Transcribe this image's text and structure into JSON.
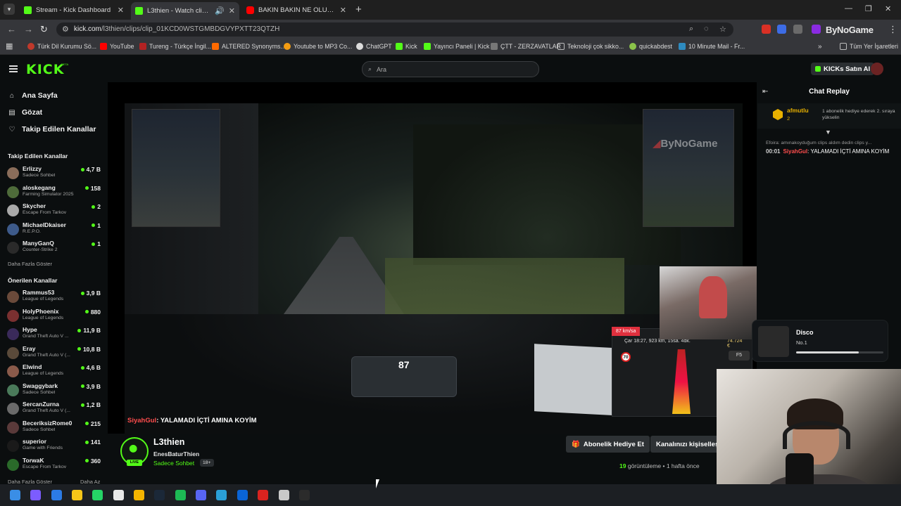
{
  "browser": {
    "tabs": [
      {
        "label": "Stream - Kick Dashboard",
        "favicon": "kick-icon"
      },
      {
        "label": "L3thien - Watch clips on Kick",
        "favicon": "kick-icon"
      },
      {
        "label": "BAKIN BAKIN NE OLUYOR? | 5...",
        "favicon": "youtube-icon"
      }
    ],
    "url_host": "kick.com",
    "url_path": "/l3thien/clips/clip_01KCD0WSTGMBDGVYPXTT23QTZH",
    "brand_overlay": "ByNoGame",
    "bookmarks": [
      "Türk Dil Kurumu Sö...",
      "YouTube",
      "Tureng - Türkçe İngil...",
      "ALTERED Synonyms...",
      "Youtube to MP3 Co...",
      "ChatGPT",
      "Kick",
      "Yayıncı Paneli | Kick",
      "ÇTT - ZERZAVATLAR",
      "Teknoloji çok sikko...",
      "quickabdest",
      "10 Minute Mail - Fr...",
      "Tüm Yer İşaretleri"
    ]
  },
  "kick": {
    "logo": "KICK",
    "logo_beta": "BETA",
    "search_placeholder": "Ara",
    "kicks_button": "KICKs Satın Al",
    "nav": [
      "Ana Sayfa",
      "Gözat",
      "Takip Edilen Kanallar"
    ],
    "followed_title": "Takip Edilen Kanallar",
    "followed": [
      {
        "name": "Erlizzy",
        "game": "Sadece Sohbet",
        "viewers": "4,7 B",
        "color": "#8a6d5a"
      },
      {
        "name": "aloskegang",
        "game": "Farming Simulator 2025",
        "viewers": "158",
        "color": "#4e6b3a"
      },
      {
        "name": "Skycher",
        "game": "Escape From Tarkov",
        "viewers": "2",
        "color": "#a9a9a9"
      },
      {
        "name": "MichaelDkaiser",
        "game": "R.E.P.O.",
        "viewers": "1",
        "color": "#3d5a8a"
      },
      {
        "name": "ManyGanQ",
        "game": "Counter-Strike 2",
        "viewers": "1",
        "color": "#2a2a2a"
      }
    ],
    "show_more": "Daha Fazla Göster",
    "recommended_title": "Önerilen Kanallar",
    "recommended": [
      {
        "name": "Rammus53",
        "game": "League of Legends",
        "viewers": "3,9 B",
        "color": "#6a4a3a"
      },
      {
        "name": "HolyPhoenix",
        "game": "League of Legends",
        "viewers": "880",
        "color": "#7a3030"
      },
      {
        "name": "Hype",
        "game": "Grand Theft Auto V ...",
        "viewers": "11,9 B",
        "color": "#3a2a5a"
      },
      {
        "name": "Eray",
        "game": "Grand Theft Auto V (...",
        "viewers": "10,8 B",
        "color": "#5a4a3a"
      },
      {
        "name": "Elwind",
        "game": "League of Legends",
        "viewers": "4,6 B",
        "color": "#8a5a4a"
      },
      {
        "name": "Swaggybark",
        "game": "Sadece Sohbet",
        "viewers": "3,9 B",
        "color": "#4a7a5a"
      },
      {
        "name": "SercanZurna",
        "game": "Grand Theft Auto V (...",
        "viewers": "1,2 B",
        "color": "#6a6a6a"
      },
      {
        "name": "BeceriksizRome0",
        "game": "Sadece Sohbet",
        "viewers": "215",
        "color": "#5a3a3a"
      },
      {
        "name": "superior",
        "game": "Game with Friends",
        "viewers": "141",
        "color": "#1a1a1a"
      },
      {
        "name": "TorwaK",
        "game": "Escape From Tarkov",
        "viewers": "360",
        "color": "#2a6a2a"
      }
    ],
    "show_more_bottom": "Daha Fazla Göster",
    "show_less": "Daha Az"
  },
  "video": {
    "speed": "87",
    "hud_speed": "87 km/sa",
    "hud_info": "Çar 18:27, 923 km, 15sa. 4dk.",
    "hud_money": "74.724 €",
    "hud_sign": "70",
    "hud_f5": "F5",
    "overlay_brand_prefix": "",
    "overlay_brand": "ByNoGame",
    "chat_user": "SiyahGul",
    "chat_text": ": YALAMADI İÇTİ AMINA KOYİM"
  },
  "stream_info": {
    "streamer": "L3thien",
    "clipper": "EnesBaturThien",
    "category": "Sadece Sohbet",
    "age": "18+",
    "live": "LIVE",
    "gift_button": "Abonelik Hediye Et",
    "customize_button": "Kanalınızı kişiselleştirin",
    "views_count": "19",
    "views_label": "görüntüleme",
    "time_ago": "1 hafta önce"
  },
  "chat": {
    "title": "Chat Replay",
    "pinned_user": "afmutlu",
    "pinned_count": "2",
    "pinned_text": "1 abonelik hediye ederek 2. sıraya yükselin",
    "reply_text": "Efoira: amınakoyduğum clips aldım dedin clips y...",
    "msg_time": "00:01",
    "msg_user": "SiyahGul",
    "msg_text": ": YALAMADI İÇTİ AMINA KOYİM"
  },
  "spotify": {
    "title": "Disco",
    "artist": "No.1",
    "progress": 0.72
  },
  "taskbar": {
    "icons": [
      "windows-start-icon",
      "copilot-icon",
      "edge-icon",
      "sticky-notes-icon",
      "whatsapp-icon",
      "chrome-icon",
      "file-explorer-icon",
      "steam-icon",
      "spotify-icon",
      "discord-icon",
      "store-icon",
      "outlook-icon",
      "acrobat-icon",
      "obs-icon",
      "terminal-icon"
    ]
  }
}
